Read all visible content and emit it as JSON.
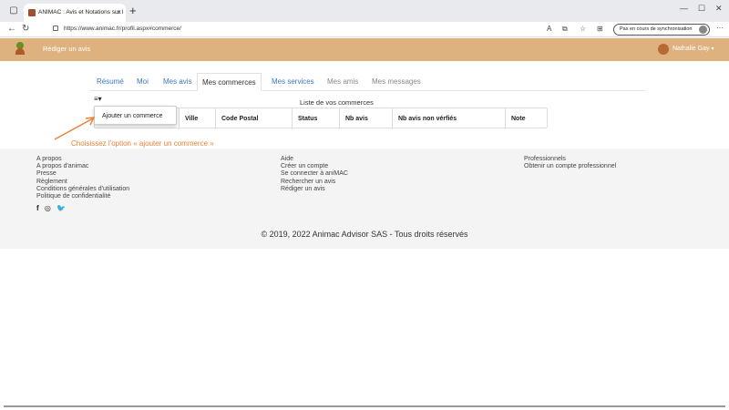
{
  "browser": {
    "tab_title": "ANIMAC : Avis et Notations sur l",
    "tab_close": "×",
    "new_tab": "+",
    "url": "https://www.animac.fr/profil.aspx#commerce/",
    "sync_label": "Pas en cours de synchronisation",
    "more": "···",
    "min": "—",
    "max": "☐",
    "close": "✕"
  },
  "header": {
    "write_review": "Rédiger un avis",
    "user_name": "Nathalie Gay",
    "caret": "▾"
  },
  "profile_nav": {
    "tabs": [
      {
        "label": "Résumé"
      },
      {
        "label": "Moi"
      },
      {
        "label": "Mes avis"
      },
      {
        "label": "Mes commerces"
      },
      {
        "label": "Mes services"
      },
      {
        "label": "Mes amis"
      },
      {
        "label": "Mes messages"
      }
    ]
  },
  "commerces": {
    "title": "Liste de vos commerces",
    "menu_icon": "≡▾",
    "dropdown_item": "Ajouter un commerce",
    "columns": [
      "Ville",
      "Code Postal",
      "Status",
      "Nb avis",
      "Nb avis non vérfiés",
      "Note"
    ]
  },
  "annotation": "Choisissez l'option « ajouter un commerce »",
  "footer": {
    "col1": [
      "A propos",
      "A propos d'animac",
      "Presse",
      "Règlement",
      "Conditions générales d'utilisation",
      "Politique de confidentialité"
    ],
    "col2": [
      "Aide",
      "Créer un compte",
      "Se connecter à aniMAC",
      "Rechercher un avis",
      "Rédiger un avis"
    ],
    "col3": [
      "Professionnels",
      "Obtenir un compte professionnel"
    ],
    "social": [
      "f",
      "◎",
      "🐦"
    ],
    "copyright": "© 2019, 2022 Animac Advisor SAS - Tous droits réservés"
  },
  "colors": {
    "header_bg": "#ddb27f",
    "link": "#3a7bbf",
    "annotation": "#e8823a"
  }
}
